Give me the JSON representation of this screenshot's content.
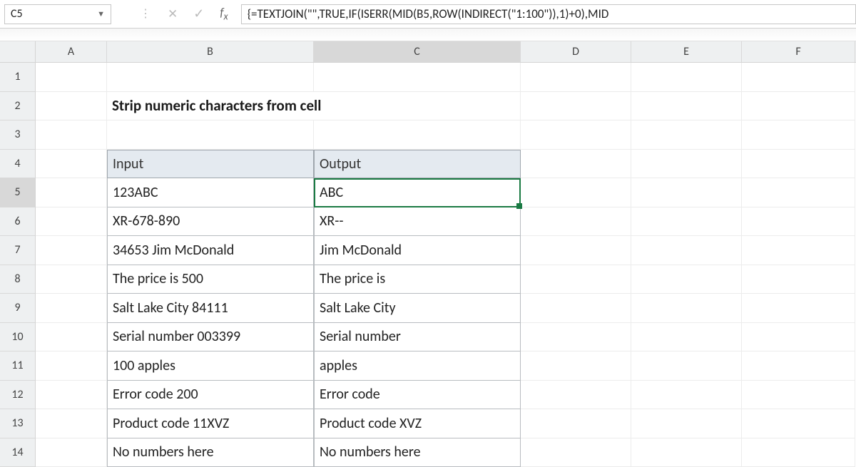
{
  "name_box": {
    "value": "C5"
  },
  "formula_bar": {
    "value": "{=TEXTJOIN(\"\",TRUE,IF(ISERR(MID(B5,ROW(INDIRECT(\"1:100\")),1)+0),MID"
  },
  "columns": [
    "A",
    "B",
    "C",
    "D",
    "E",
    "F"
  ],
  "rows": [
    "1",
    "2",
    "3",
    "4",
    "5",
    "6",
    "7",
    "8",
    "9",
    "10",
    "11",
    "12",
    "13",
    "14"
  ],
  "selected": {
    "col": "C",
    "row": "5"
  },
  "title": "Strip numeric characters from cell",
  "table": {
    "header": {
      "input": "Input",
      "output": "Output"
    },
    "data": [
      {
        "input": "123ABC",
        "output": "ABC"
      },
      {
        "input": "XR-678-890",
        "output": "XR--"
      },
      {
        "input": "34653 Jim McDonald",
        "output": " Jim McDonald"
      },
      {
        "input": "The price is 500",
        "output": "The price is "
      },
      {
        "input": "Salt Lake City 84111",
        "output": "Salt Lake City "
      },
      {
        "input": "Serial number 003399",
        "output": "Serial number "
      },
      {
        "input": "100 apples",
        "output": " apples"
      },
      {
        "input": "Error code 200",
        "output": "Error code "
      },
      {
        "input": "Product code 11XVZ",
        "output": "Product code XVZ"
      },
      {
        "input": "No numbers here",
        "output": "No numbers here"
      }
    ]
  }
}
